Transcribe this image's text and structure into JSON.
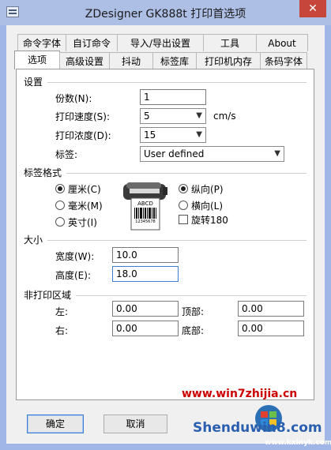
{
  "window": {
    "title": "ZDesigner GK888t 打印首选项",
    "close_glyph": "✕"
  },
  "tabs_back": [
    "命令字体",
    "自订命令",
    "导入/导出设置",
    "工具",
    "About"
  ],
  "tabs_front": [
    "选项",
    "高级设置",
    "抖动",
    "标签库",
    "打印机内存",
    "条码字体"
  ],
  "settings": {
    "heading": "设置",
    "copies_label": "份数(N):",
    "copies_value": "1",
    "speed_label": "打印速度(S):",
    "speed_value": "5",
    "speed_unit": "cm/s",
    "darkness_label": "打印浓度(D):",
    "darkness_value": "15",
    "stock_label": "标签:",
    "stock_value": "User defined"
  },
  "label_format": {
    "heading": "标签格式",
    "unit_cm": "厘米(C)",
    "unit_mm": "毫米(M)",
    "unit_in": "英寸(I)",
    "portrait": "纵向(P)",
    "landscape": "横向(L)",
    "rotate": "旋转180",
    "printer_label_text": "ABCD",
    "printer_label_number": "12345678"
  },
  "size": {
    "heading": "大小",
    "width_label": "宽度(W):",
    "width_value": "10.0",
    "height_label": "高度(E):",
    "height_value": "18.0"
  },
  "unprintable": {
    "heading": "非打印区域",
    "left_label": "左:",
    "left_value": "0.00",
    "top_label": "顶部:",
    "top_value": "0.00",
    "right_label": "右:",
    "right_value": "0.00",
    "bottom_label": "底部:",
    "bottom_value": "0.00"
  },
  "buttons": {
    "ok": "确定",
    "cancel": "取消"
  },
  "watermarks": {
    "site1": "www.win7zhijia.cn",
    "site2": "Shenduwin8.com",
    "site3": "www.kxinyk.com"
  }
}
